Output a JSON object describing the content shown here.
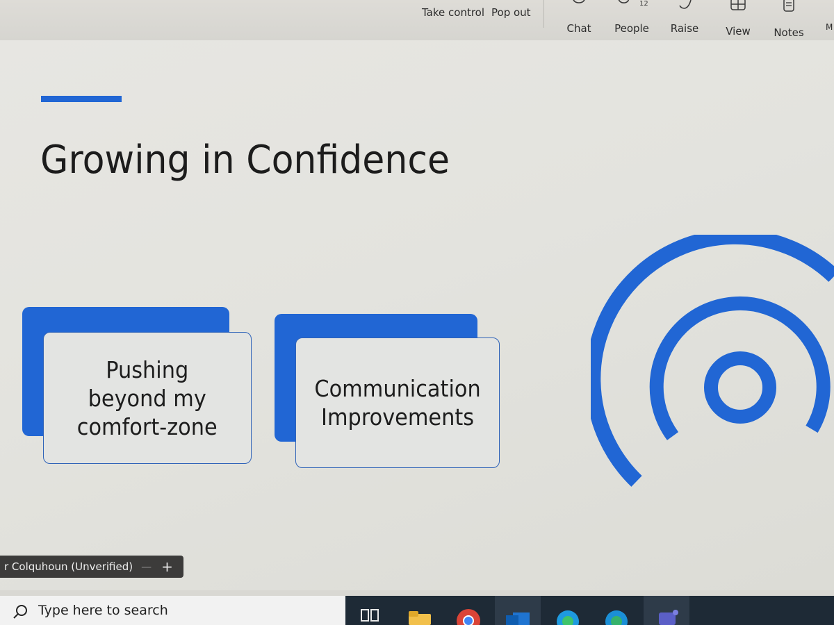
{
  "toolbar": {
    "take_control": "Take control",
    "pop_out": "Pop out",
    "buttons": [
      {
        "label": "Chat",
        "icon": "chat-icon"
      },
      {
        "label": "People",
        "icon": "people-icon"
      },
      {
        "label": "Raise",
        "icon": "hand-icon"
      },
      {
        "label": "View",
        "icon": "grid-icon"
      },
      {
        "label": "Notes",
        "icon": "notes-icon"
      }
    ],
    "people_count": "12",
    "more_label": "M"
  },
  "slide": {
    "title": "Growing in Confidence",
    "cards": [
      {
        "text": "Pushing\nbeyond my\ncomfort-zone"
      },
      {
        "text": "Communication\nImprovements"
      }
    ],
    "accent_color": "#2166d4"
  },
  "presenter": {
    "name": "r Colquhoun (Unverified)",
    "separator": "—",
    "plus": "+"
  },
  "taskbar": {
    "search_placeholder": "Type here to search",
    "apps": [
      "task-view-icon",
      "file-explorer-icon",
      "chrome-icon",
      "outlook-icon",
      "edge-icon",
      "edge-dev-icon",
      "teams-icon"
    ]
  }
}
